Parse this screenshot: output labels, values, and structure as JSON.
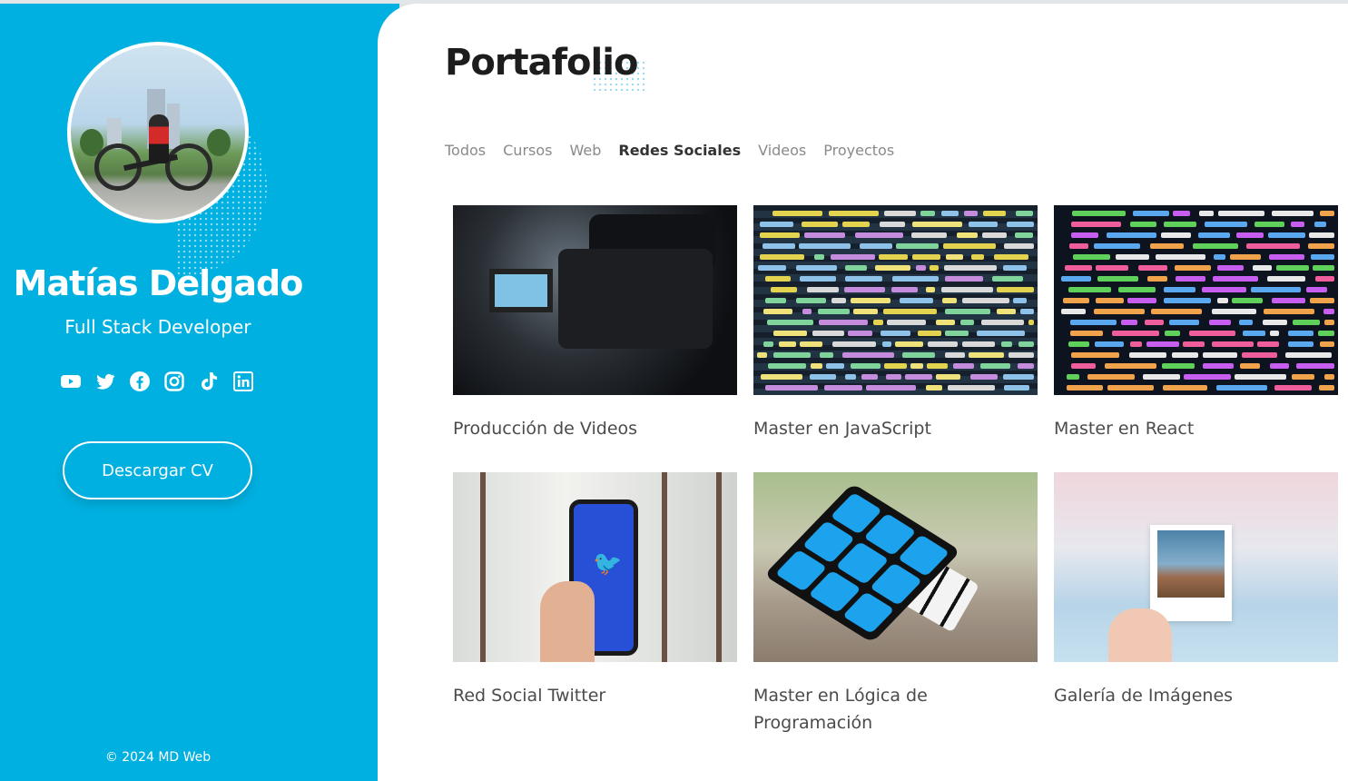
{
  "profile": {
    "name": "Matías Delgado",
    "role": "Full Stack Developer",
    "cv_button": "Descargar CV",
    "copyright": "© 2024 MD Web",
    "socials": [
      "youtube-icon",
      "twitter-icon",
      "facebook-icon",
      "instagram-icon",
      "tiktok-icon",
      "linkedin-icon"
    ]
  },
  "portfolio": {
    "title": "Portafolio",
    "filters": [
      {
        "label": "Todos",
        "active": false
      },
      {
        "label": "Cursos",
        "active": false
      },
      {
        "label": "Web",
        "active": false
      },
      {
        "label": "Redes Sociales",
        "active": true
      },
      {
        "label": "Videos",
        "active": false
      },
      {
        "label": "Proyectos",
        "active": false
      }
    ],
    "items": [
      {
        "title": "Producción de Videos",
        "image": "video-camera"
      },
      {
        "title": "Master en JavaScript",
        "image": "javascript-code"
      },
      {
        "title": "Master en React",
        "image": "react-code"
      },
      {
        "title": "Red Social Twitter",
        "image": "twitter-phone"
      },
      {
        "title": "Master en Lógica de Programación",
        "image": "rubiks-cube"
      },
      {
        "title": "Galería de Imágenes",
        "image": "polaroid-photo"
      }
    ]
  },
  "colors": {
    "sidebar": "#00b0e0",
    "accent_text": "#333333",
    "muted_text": "#8a8a8a"
  }
}
